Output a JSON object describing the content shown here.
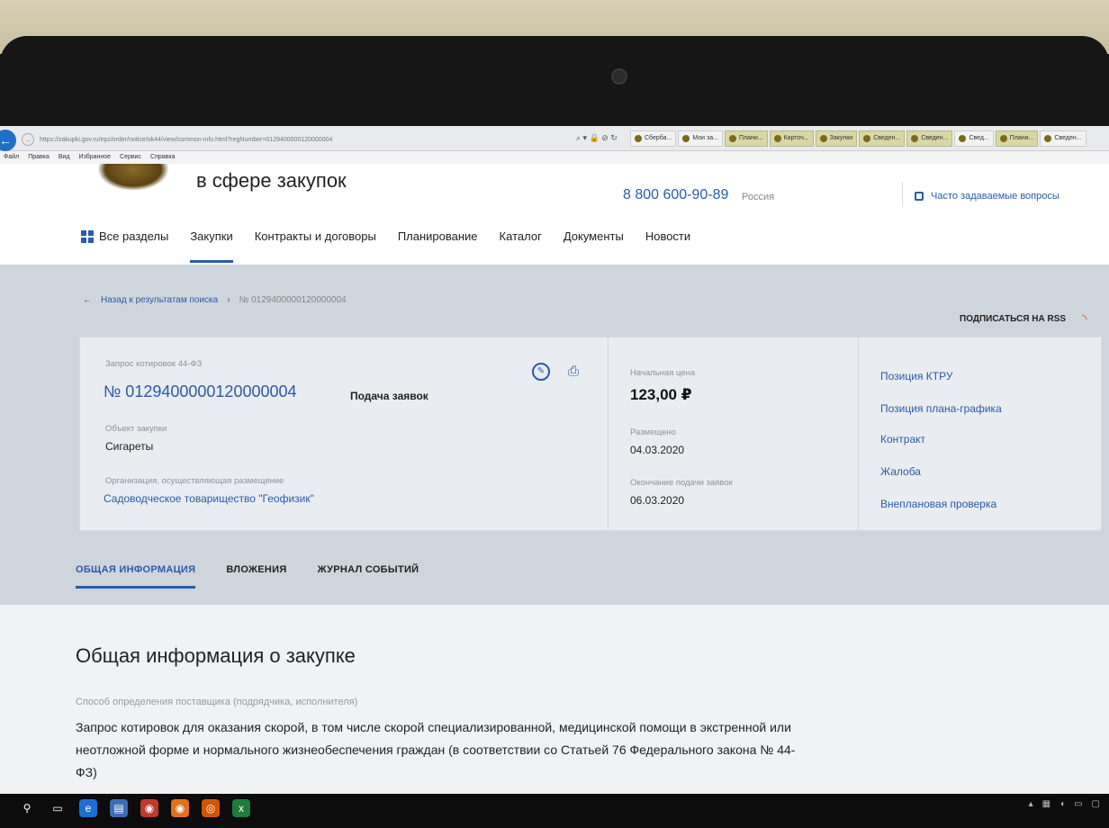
{
  "browser": {
    "url": "https://zakupki.gov.ru/epz/order/notice/ok44/view/common-info.html?regNumber=0129400000120000004",
    "menu": [
      "Файл",
      "Правка",
      "Вид",
      "Избранное",
      "Сервис",
      "Справка"
    ],
    "tabs": [
      "Сберба...",
      "Мои за...",
      "Плани...",
      "Карточ...",
      "Закупки",
      "Сведен...",
      "Сведен...",
      "Свед...",
      "Плани...",
      "Сведен..."
    ]
  },
  "header": {
    "title": "в сфере закупок",
    "phone": "8 800 600-90-89",
    "region": "Россия",
    "faq": "Часто задаваемые вопросы"
  },
  "nav": {
    "all_sections": "Все разделы",
    "items": [
      "Закупки",
      "Контракты и договоры",
      "Планирование",
      "Каталог",
      "Документы",
      "Новости"
    ]
  },
  "breadcrumb": {
    "back": "Назад к результатам поиска",
    "current": "№ 0129400000120000004"
  },
  "rss": "ПОДПИСАТЬСЯ НА RSS",
  "card": {
    "type": "Запрос котировок 44-ФЗ",
    "reg_number": "№ 0129400000120000004",
    "stage": "Подача заявок",
    "object_label": "Объект закупки",
    "object_value": "Сигареты",
    "org_label": "Организация, осуществляющая размещение",
    "org_value": "Садоводческое товарищество \"Геофизик\"",
    "price_label": "Начальная цена",
    "price_value": "123,00 ₽",
    "posted_label": "Размещено",
    "posted_value": "04.03.2020",
    "deadline_label": "Окончание подачи заявок",
    "deadline_value": "06.03.2020",
    "links": [
      "Позиция КТРУ",
      "Позиция плана-графика",
      "Контракт",
      "Жалоба",
      "Внеплановая проверка"
    ]
  },
  "content_tabs": [
    "ОБЩАЯ ИНФОРМАЦИЯ",
    "ВЛОЖЕНИЯ",
    "ЖУРНАЛ СОБЫТИЙ"
  ],
  "section": {
    "title": "Общая информация о закупке",
    "method_label": "Способ определения поставщика (подрядчика, исполнителя)",
    "method_value": "Запрос котировок для оказания скорой, в том числе скорой специализированной, медицинской помощи в экстренной или неотложной форме и нормального жизнеобеспечения граждан (в соответствии со Статьей 76 Федерального закона № 44-ФЗ)"
  },
  "colors": {
    "accent": "#2a5ca8",
    "rss": "#d9381e"
  }
}
